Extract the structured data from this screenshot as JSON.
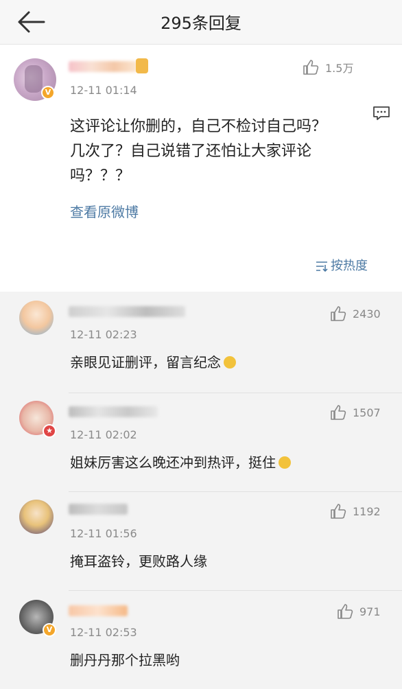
{
  "header": {
    "title": "295条回复"
  },
  "main_comment": {
    "time": "12-11 01:14",
    "likes": "1.5万",
    "text_line1": "这评论让你删的，自己不检讨自己吗？",
    "text_line2": "几次了？自己说错了还怕让大家评论",
    "text_line3": "吗？？？",
    "view_original": "查看原微博",
    "sort_label": "按热度"
  },
  "replies": [
    {
      "time": "12-11 02:23",
      "likes": "2430",
      "text": "亲眼见证删评，留言纪念"
    },
    {
      "time": "12-11 02:02",
      "likes": "1507",
      "text": "姐妹厉害这么晚还冲到热评，挺住"
    },
    {
      "time": "12-11 01:56",
      "likes": "1192",
      "text": "掩耳盗铃，更败路人缘"
    },
    {
      "time": "12-11 02:53",
      "likes": "971",
      "text": "删丹丹那个拉黑哟"
    }
  ],
  "icons": {
    "back": "back-arrow-icon",
    "like": "thumb-up-icon",
    "comment": "comment-icon",
    "sort": "sort-icon",
    "verified": "verified-badge-icon"
  },
  "colors": {
    "link": "#4d7aa4",
    "verified_badge": "#f4a62a",
    "time": "#8a8a8a"
  }
}
